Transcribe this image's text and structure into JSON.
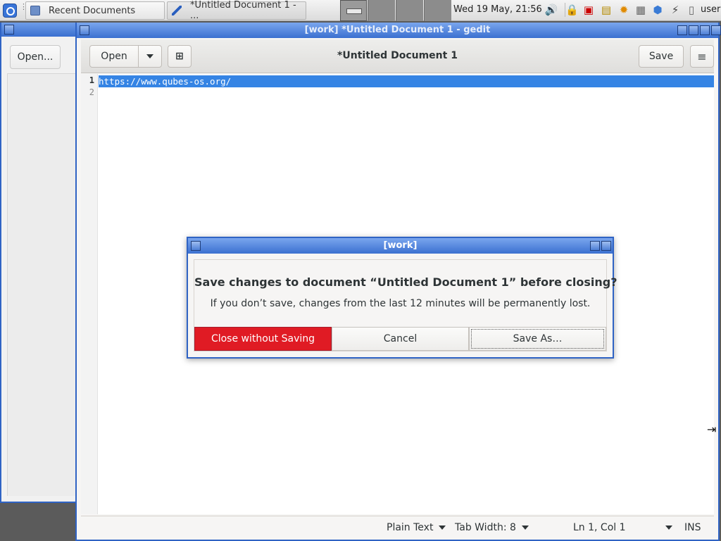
{
  "taskbar": {
    "tasks": [
      {
        "label": "Recent Documents",
        "icon": "document-icon"
      },
      {
        "label": "*Untitled Document 1 - ...",
        "icon": "text-editor-icon"
      }
    ],
    "clock": "Wed 19 May, 21:56",
    "user": "user",
    "tray_icons": [
      "volume-icon",
      "lock-icon",
      "network-icon",
      "qube-manager-icon",
      "updates-icon",
      "clipboard-icon",
      "domains-icon",
      "devices-icon",
      "disk-icon"
    ]
  },
  "background_window": {
    "open_label": "Open..."
  },
  "gedit": {
    "window_title": "[work] *Untitled Document 1 - gedit",
    "open_label": "Open",
    "doc_title": "*Untitled Document 1",
    "save_label": "Save",
    "lines": [
      {
        "number": "1",
        "text": "https://www.qubes-os.org/"
      },
      {
        "number": "2",
        "text": ""
      }
    ],
    "status": {
      "language": "Plain Text",
      "tab_width": "Tab Width: 8",
      "position": "Ln 1, Col 1",
      "mode": "INS"
    }
  },
  "dialog": {
    "title": "[work]",
    "heading": "Save changes to document “Untitled Document 1” before closing?",
    "message": "If you don’t save, changes from the last 12 minutes will be permanently lost.",
    "buttons": {
      "close_without_saving": "Close without Saving",
      "cancel": "Cancel",
      "save_as": "Save As…"
    }
  },
  "colors": {
    "title_bar": "#3b70d0",
    "selection": "#3584e4",
    "destructive": "#e01b24"
  }
}
